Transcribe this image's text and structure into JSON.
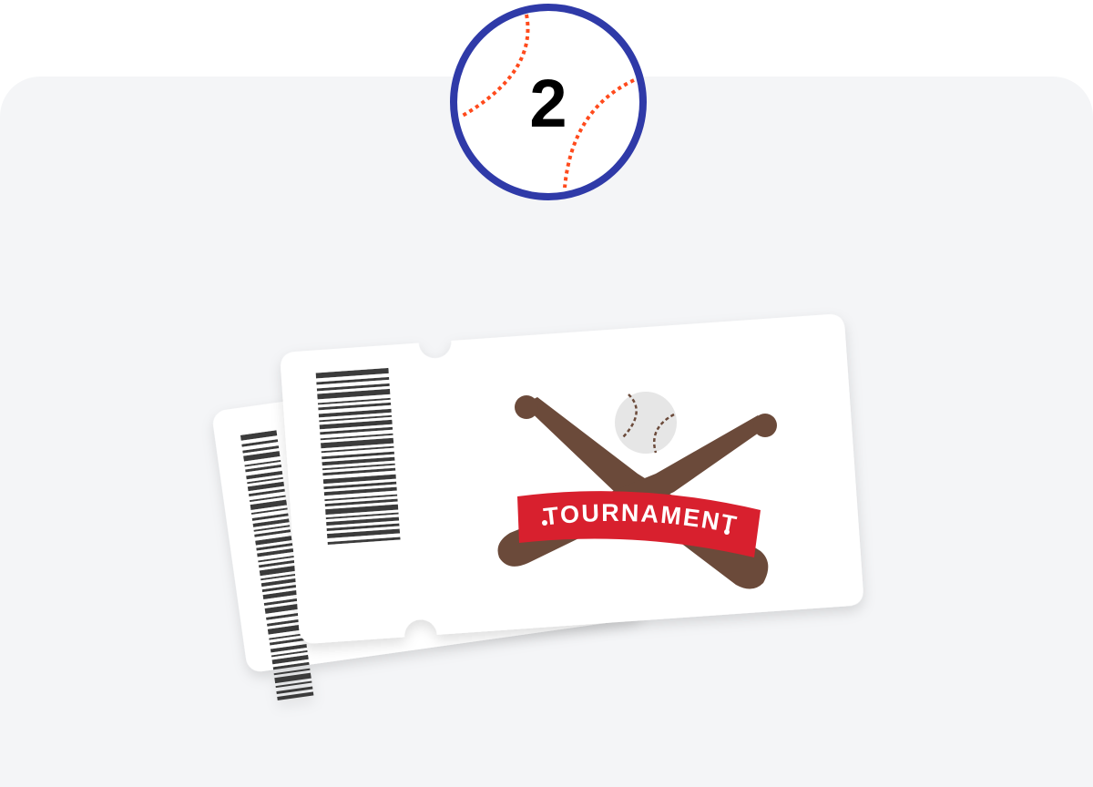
{
  "step": {
    "number": "2"
  },
  "ticket": {
    "banner_text": "TOURNAMENT"
  },
  "colors": {
    "panel_bg": "#f4f5f7",
    "badge_ring": "#2f3aa8",
    "stitch": "#ff4a1c",
    "bat": "#6b4a3a",
    "banner": "#d8202e",
    "barcode": "#3a3a3a"
  },
  "icons": {
    "badge": "baseball-icon",
    "emblem": "crossed-bats-icon",
    "ball": "baseball-icon"
  }
}
